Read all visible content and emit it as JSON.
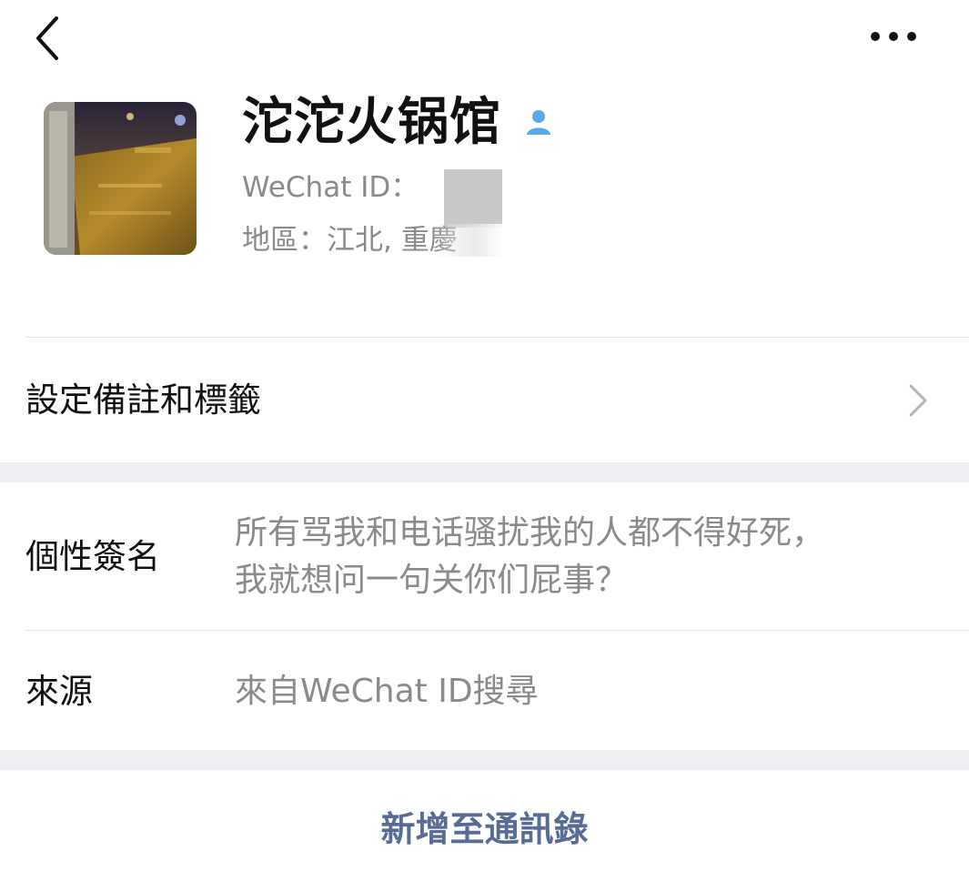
{
  "nav": {
    "back_icon": "chevron-left-icon",
    "more_icon": "ellipsis-icon"
  },
  "profile": {
    "name": "沱沱火锅馆",
    "wechat_id_label": "WeChat ID：",
    "region_label": "地區：",
    "region_value": "江北, 重慶",
    "verify_icon": "person-icon"
  },
  "remark_row": {
    "label": "設定備註和標籤",
    "chevron_icon": "chevron-right-icon"
  },
  "signature_row": {
    "label": "個性簽名",
    "value_line1": "所有骂我和电话骚扰我的人都不得好死，",
    "value_line2": "我就想问一句关你们屁事？"
  },
  "source_row": {
    "label": "來源",
    "value": "來自WeChat ID搜尋"
  },
  "add_button": {
    "label": "新增至通訊錄"
  },
  "colors": {
    "link": "#576b95",
    "secondary_text": "#8a8a8a",
    "separator_bg": "#efeff3",
    "verify_icon": "#5aa9e6"
  }
}
